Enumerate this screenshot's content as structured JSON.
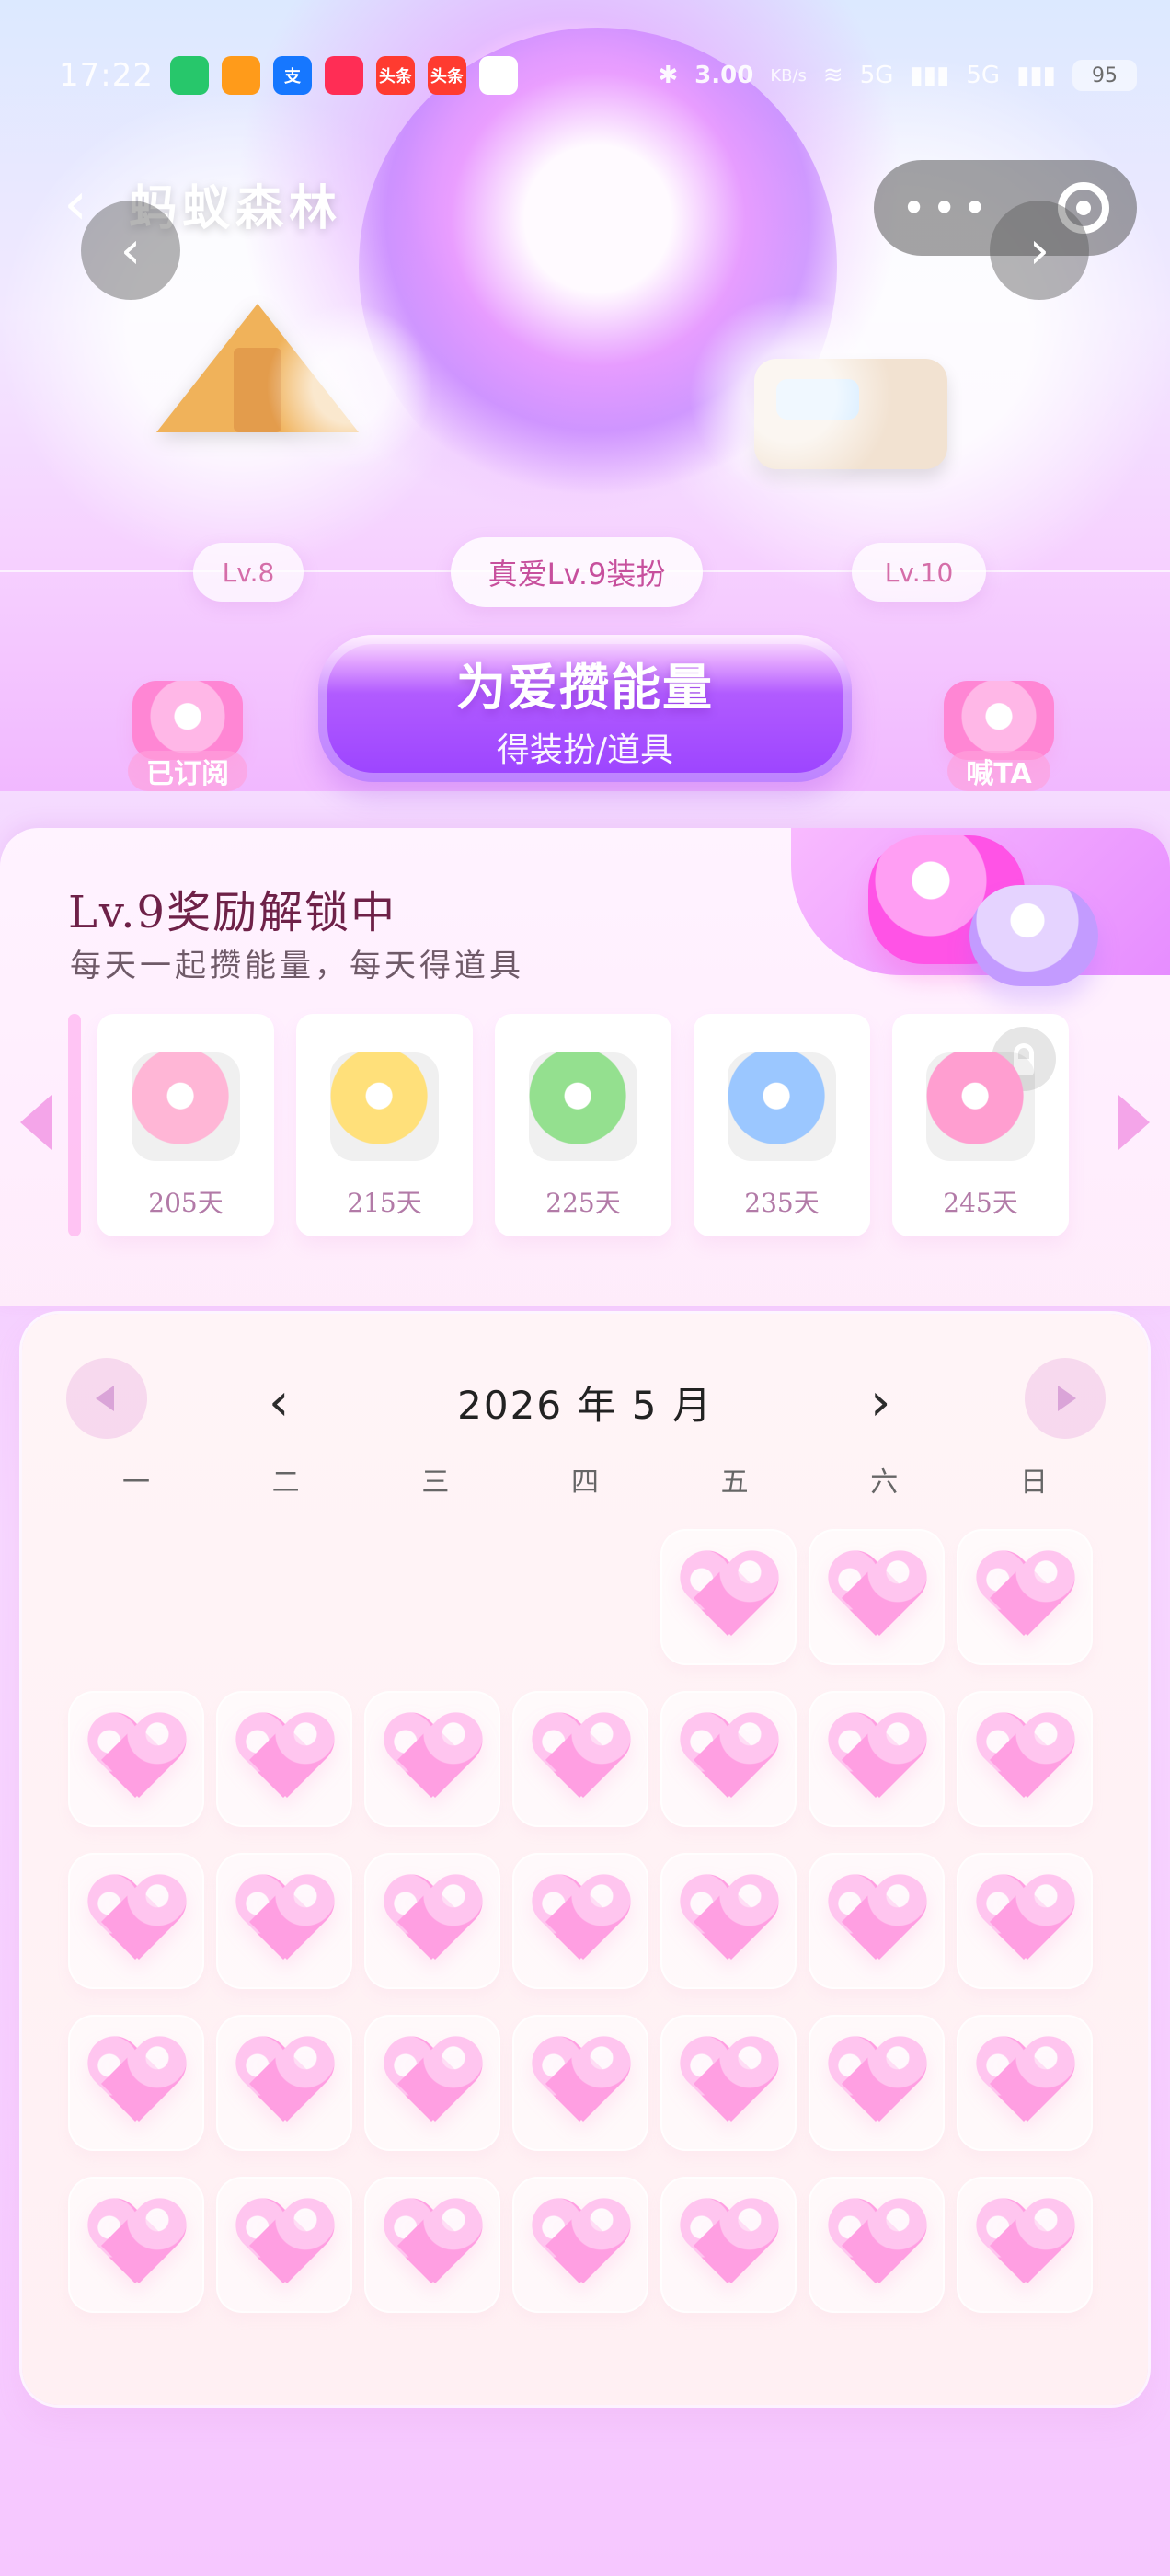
{
  "status_bar": {
    "time": "17:22",
    "apps": [
      {
        "name": "camera-app-icon",
        "label": "",
        "color": "#27c76b"
      },
      {
        "name": "weibo-app-icon",
        "label": "",
        "color": "#ff9b1a"
      },
      {
        "name": "alipay-app-icon",
        "label": "支",
        "color": "#1677ff"
      },
      {
        "name": "video-app-icon",
        "label": "",
        "color": "#ff2d55"
      },
      {
        "name": "toutiao-app-icon",
        "label": "头条",
        "color": "#ff3b30"
      },
      {
        "name": "toutiao-app-icon-2",
        "label": "头条",
        "color": "#ff3b30"
      },
      {
        "name": "chat-app-icon",
        "label": "",
        "color": "#ffffff"
      }
    ],
    "bluetooth_icon": "bluetooth-icon",
    "net_speed": "3.00",
    "net_unit": "KB/s",
    "signal1": "5G",
    "signal2": "5G",
    "battery": "95"
  },
  "top_bar": {
    "title": "蚂蚁森林",
    "back_icon": "chevron-left-icon",
    "menu_label": "•••",
    "record_icon": "record-icon"
  },
  "levels": {
    "left": "Lv.8",
    "current": "真爱Lv.9装扮",
    "right": "Lv.10"
  },
  "actions": {
    "left_badge": "已订阅",
    "cta_main": "为爱攒能量",
    "cta_sub": "得装扮/道具",
    "right_badge": "喊TA"
  },
  "reward": {
    "title": "Lv.9奖励解锁中",
    "subtitle": "每天一起攒能量，每天得道具",
    "items": [
      {
        "name": "flower-pot-item",
        "days": "205天",
        "color": "#ffb6d6"
      },
      {
        "name": "lemon-item",
        "days": "215天",
        "color": "#ffe07a"
      },
      {
        "name": "cactus-pot-item",
        "days": "225天",
        "color": "#94e08f"
      },
      {
        "name": "bird-item",
        "days": "235天",
        "color": "#9bc7ff"
      },
      {
        "name": "bear-tissue-box-item",
        "days": "245天",
        "color": "#ff9ed0",
        "locked": true
      }
    ]
  },
  "calendar": {
    "month_label": "2026 年 5 月",
    "prev_symbol": "‹",
    "next_symbol": "›",
    "weekdays": [
      "一",
      "二",
      "三",
      "四",
      "五",
      "六",
      "日"
    ]
  }
}
